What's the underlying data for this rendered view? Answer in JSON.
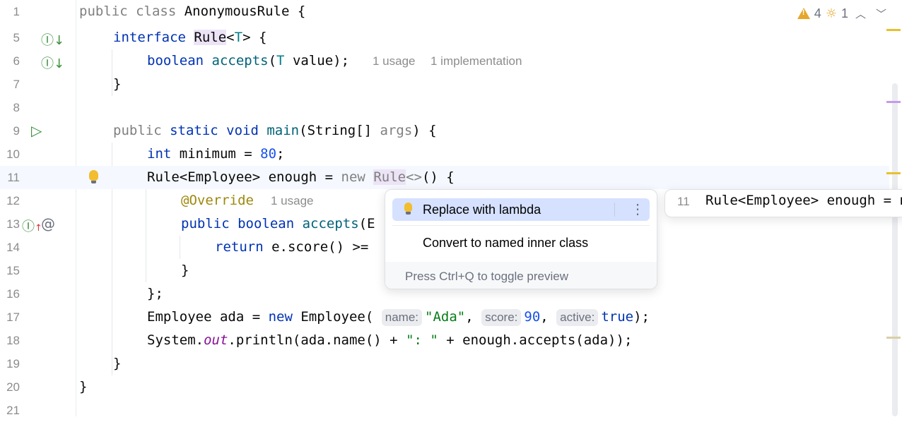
{
  "editor": {
    "lines": [
      {
        "n": "1",
        "code": "public class AnonymousRule {"
      },
      {
        "n": "5",
        "code": "interface Rule<T> {"
      },
      {
        "n": "6",
        "code": "boolean accepts(T value);",
        "hint1": "1 usage",
        "hint2": "1 implementation"
      },
      {
        "n": "7",
        "code": "}"
      },
      {
        "n": "8",
        "code": ""
      },
      {
        "n": "9",
        "code": "public static void main(String[] args) {"
      },
      {
        "n": "10",
        "code": "int minimum = 80;"
      },
      {
        "n": "11",
        "code": "Rule<Employee> enough = new Rule<>() {"
      },
      {
        "n": "12",
        "code": "@Override",
        "hint1": "1 usage"
      },
      {
        "n": "13",
        "code": "public boolean accepts(E"
      },
      {
        "n": "14",
        "code": "return e.score() >="
      },
      {
        "n": "15",
        "code": "}"
      },
      {
        "n": "16",
        "code": "};"
      },
      {
        "n": "17",
        "code": "Employee ada = new Employee(name: \"Ada\", score: 90, active: true);",
        "p_name": "name:",
        "p_score": "score:",
        "p_active": "active:"
      },
      {
        "n": "18",
        "code": "System.out.println(ada.name() + \": \" + enough.accepts(ada));"
      },
      {
        "n": "19",
        "code": "}"
      },
      {
        "n": "20",
        "code": "}"
      },
      {
        "n": "21",
        "code": ""
      }
    ]
  },
  "inspections": {
    "warnings": "4",
    "weak_warnings": "1"
  },
  "popup": {
    "items": [
      {
        "label": "Replace with lambda",
        "selected": true
      },
      {
        "label": "Convert to named inner class",
        "selected": false
      }
    ],
    "more": "⋮",
    "footer": "Press Ctrl+Q to toggle preview"
  },
  "preview": {
    "line_number": "11",
    "code": "Rule<Employee> enough = new Employee() {"
  },
  "colors": {
    "keyword": "#0033b3",
    "number": "#1750eb",
    "string": "#067d17",
    "annotation": "#9e880d",
    "selection": "#d5e1ff"
  }
}
